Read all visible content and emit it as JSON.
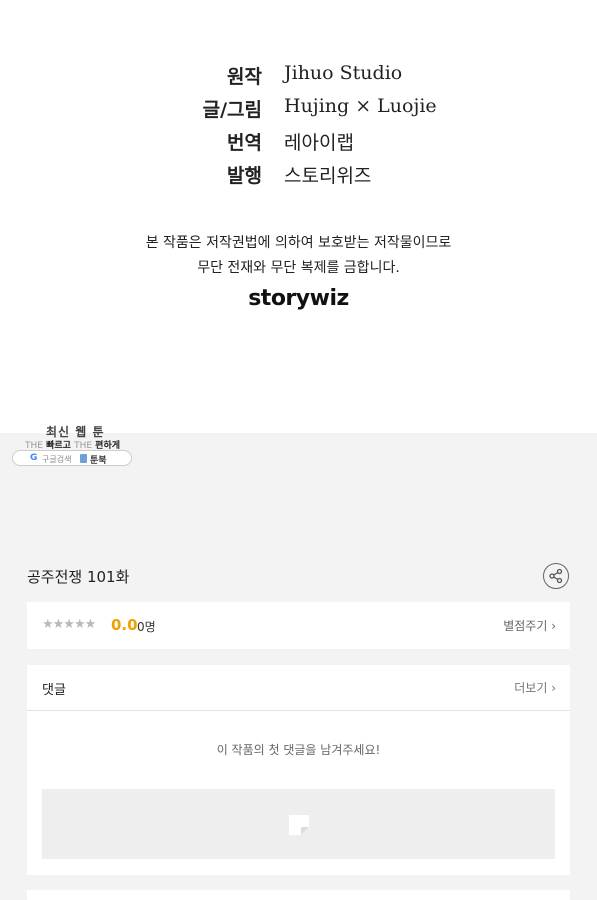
{
  "credits": [
    {
      "label": "원작",
      "value": "Jihuo Studio"
    },
    {
      "label": "글/그림",
      "value": "Hujing × Luojie"
    },
    {
      "label": "번역",
      "value": "레아이랩"
    },
    {
      "label": "발행",
      "value": "스토리위즈"
    }
  ],
  "notice": {
    "line1": "본 작품은 저작권법에 의하여 보호받는 저작물이므로",
    "line2": "무단 전재와 무단 복제를 금합니다."
  },
  "logo_text": "storywiz",
  "promo": {
    "title": "최신 웹 툰",
    "the1": "THE",
    "fast": "빠르고",
    "the2": "THE",
    "easy": "편하게",
    "google_g": "G",
    "google_search": "구글검색",
    "toonbook": "툰북"
  },
  "episode": {
    "title": "공주전쟁 101화"
  },
  "rating": {
    "stars": "★★★★★",
    "score": "0.0",
    "count": "0명",
    "rate_link": "별점주기 ›"
  },
  "comments": {
    "title": "댓글",
    "more_link": "더보기 ›",
    "empty_message": "이 작품의 첫 댓글을 남겨주세요!"
  },
  "icons": {
    "share": "share-icon",
    "pencil": "pencil-icon"
  },
  "colors": {
    "score": "#f0a000",
    "background": "#f3f3f3"
  }
}
